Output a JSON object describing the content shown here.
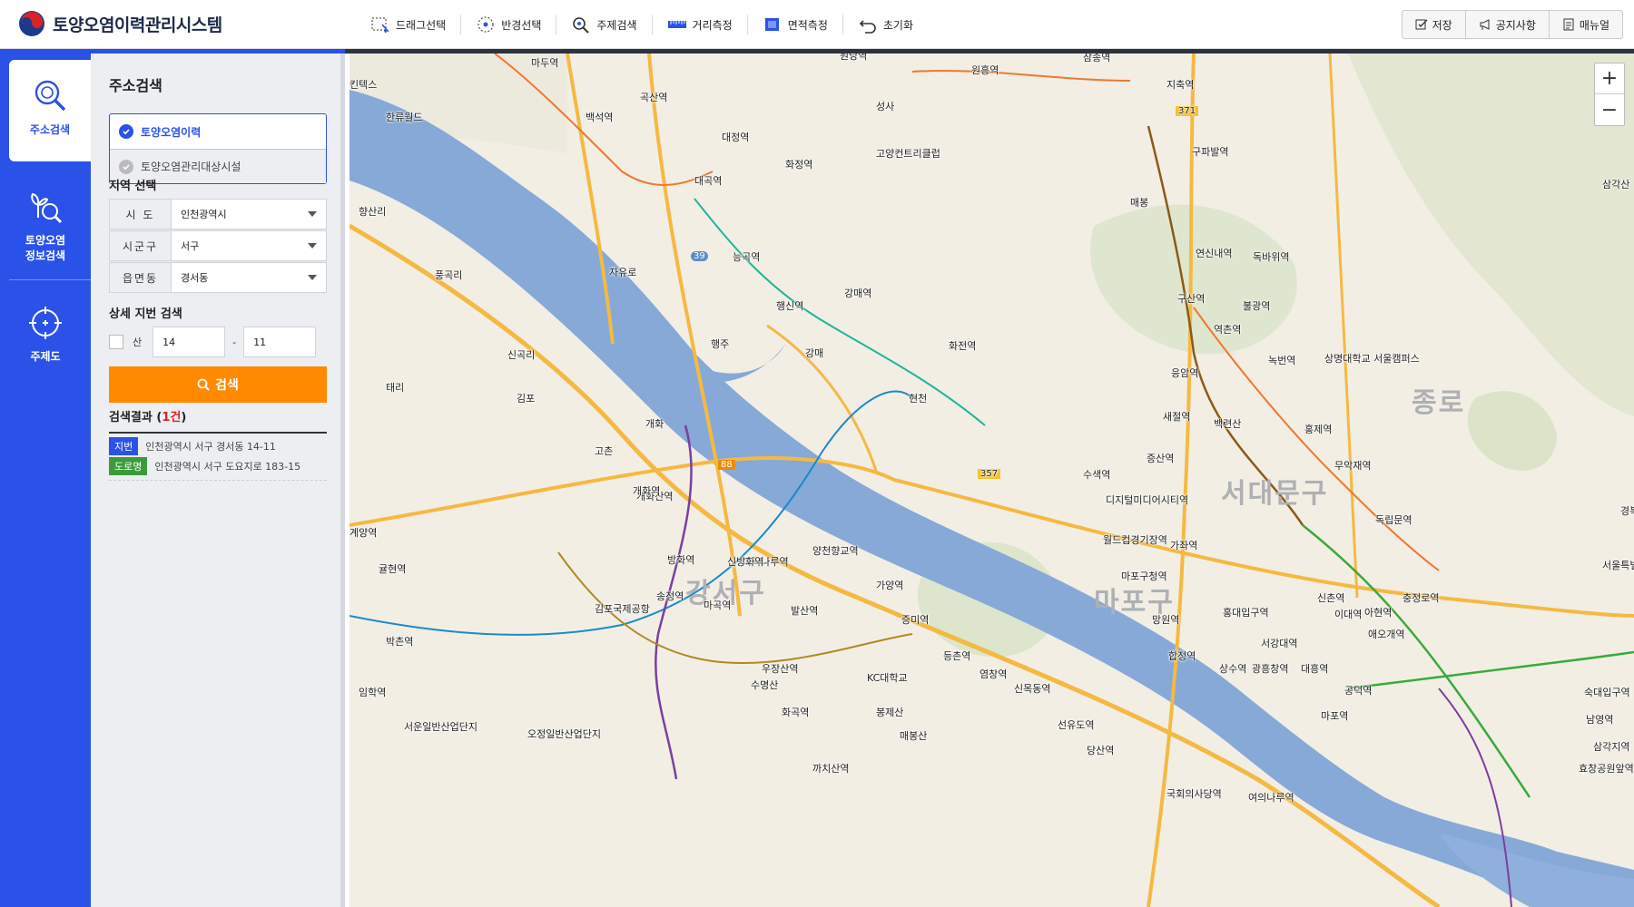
{
  "app": {
    "title": "토양오염이력관리시스템"
  },
  "toolbar": [
    {
      "label": "드래그선택",
      "icon": "drag-select-icon"
    },
    {
      "label": "반경선택",
      "icon": "radius-select-icon"
    },
    {
      "label": "주제검색",
      "icon": "theme-search-icon"
    },
    {
      "label": "거리측정",
      "icon": "ruler-icon"
    },
    {
      "label": "면적측정",
      "icon": "area-icon"
    },
    {
      "label": "초기화",
      "icon": "reset-icon"
    }
  ],
  "right_buttons": {
    "save": "저장",
    "notice": "공지사항",
    "manual": "매뉴얼"
  },
  "rail": {
    "address": "주소검색",
    "soil_line1": "토양오염",
    "soil_line2": "정보검색",
    "theme": "주제도"
  },
  "panel": {
    "title": "주소검색",
    "options": {
      "selected": "토양오염이력",
      "unselected": "토양오염관리대상시설"
    },
    "region_label": "지역 선택",
    "sido": {
      "label": "시 도",
      "value": "인천광역시"
    },
    "sigungu": {
      "label": "시군구",
      "value": "서구"
    },
    "dong": {
      "label": "읍면동",
      "value": "경서동"
    },
    "detail_label": "상세 지번 검색",
    "san": "산",
    "main_no": "14",
    "dash": "-",
    "sub_no": "11",
    "search_button": "검색",
    "results": {
      "prefix": "검색결과 (",
      "count": "1건",
      "suffix": ")",
      "jibun_tag": "지번",
      "jibun_addr": "인천광역시 서구 경서동 14-11",
      "road_tag": "도로명",
      "road_addr": "인천광역시 서구 도요지로 183-15"
    }
  },
  "map": {
    "zoom_in": "+",
    "zoom_out": "−",
    "districts": [
      "마포구",
      "서대문구",
      "강서구",
      "종로"
    ],
    "stations": [
      "마두역",
      "곡산역",
      "백석역",
      "대곡역",
      "화정역",
      "능곡역",
      "행신역",
      "강매역",
      "화전역",
      "원당역",
      "원흥역",
      "삼송역",
      "지축역",
      "구파발역",
      "연신내역",
      "독바위역",
      "구산역",
      "불광역",
      "역촌역",
      "녹번역",
      "응암역",
      "새절역",
      "증산역",
      "홍제역",
      "무악재역",
      "디지털미디어시티역",
      "수색역",
      "가좌역",
      "월드컵경기장역",
      "마포구청역",
      "망원역",
      "합정역",
      "홍대입구역",
      "신촌역",
      "이대역",
      "아현역",
      "충정로역",
      "애오개역",
      "서강대역",
      "광흥창역",
      "대흥역",
      "공덕역",
      "마포역",
      "상수역",
      "당산역",
      "선유도역",
      "신목동역",
      "염창역",
      "등촌역",
      "증미역",
      "가양역",
      "양천향교역",
      "마곡나루역",
      "신방화역",
      "방화역",
      "개화산역",
      "개화역",
      "송정역",
      "마곡역",
      "발산역",
      "우장산역",
      "화곡역",
      "까치산역",
      "김포공항역",
      "계양역",
      "귤현역",
      "박촌역",
      "임학역",
      "국회의사당역",
      "여의나루역",
      "숙대입구역",
      "남영역",
      "삼각지역",
      "효창공원앞역",
      "독립문역",
      "경복궁역"
    ],
    "places": [
      "한류월드",
      "킨텍스",
      "성사",
      "대정역",
      "고양컨트리클럽",
      "매봉",
      "삼각산",
      "향산리",
      "신곡리",
      "태리",
      "풍곡리",
      "김포",
      "고촌",
      "개화",
      "행주",
      "강매",
      "현천",
      "자유로",
      "김포국제공항",
      "수명산",
      "KC대학교",
      "봉제산",
      "매봉산",
      "서운일반산업단지",
      "오정일반산업단지",
      "상명대학교 서울캠퍼스",
      "백련산",
      "서울특별시"
    ],
    "highway_numbers": [
      "371",
      "39",
      "357",
      "88"
    ]
  }
}
